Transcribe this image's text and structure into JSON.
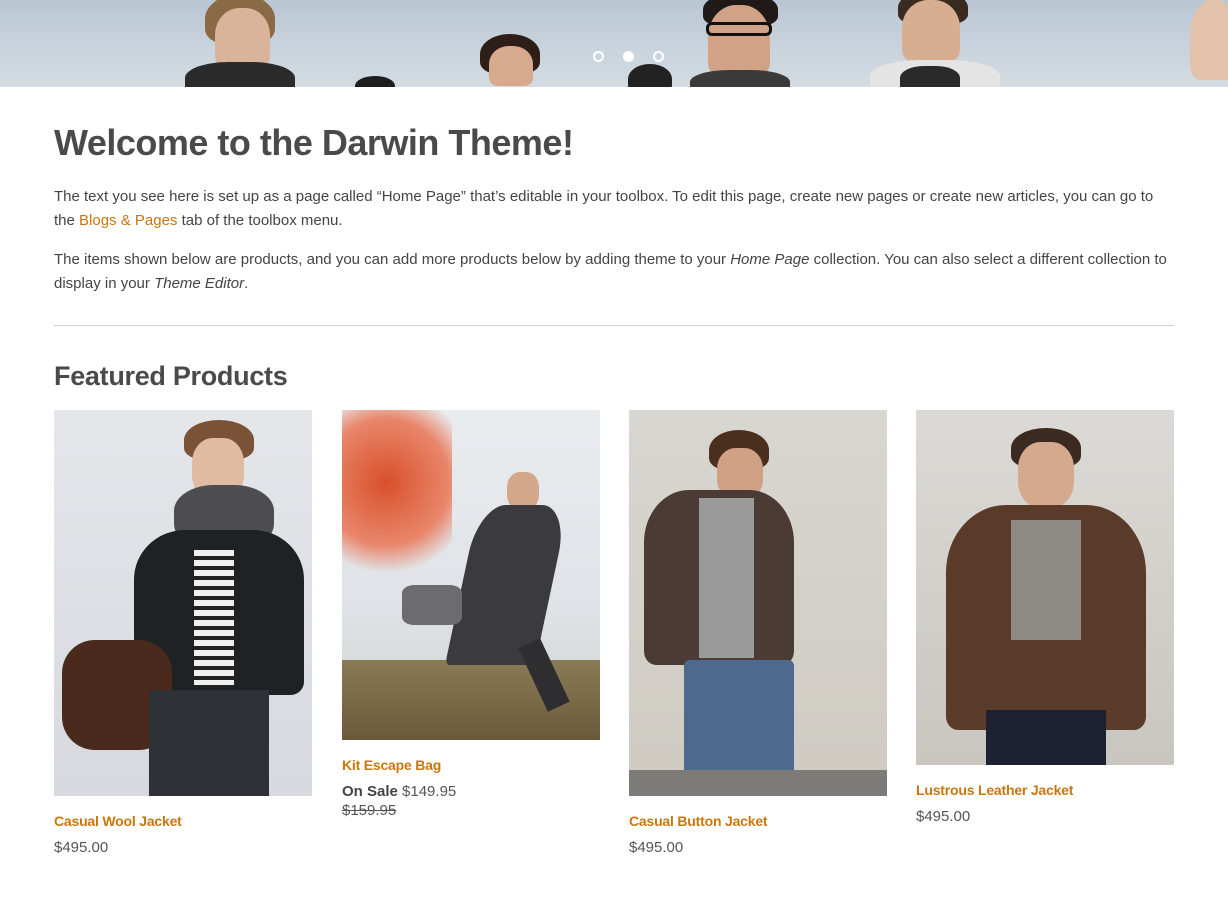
{
  "hero": {
    "slides": [
      {
        "label": "Slide 1",
        "active": false
      },
      {
        "label": "Slide 2",
        "active": true
      },
      {
        "label": "Slide 3",
        "active": false
      }
    ]
  },
  "page": {
    "title": "Welcome to the Darwin Theme!",
    "intro": {
      "p1_before": "The text you see here is set up as a page called “Home Page” that’s editable in your toolbox. To edit this page, create new pages or create new articles, you can go to the ",
      "p1_link": "Blogs & Pages",
      "p1_after": " tab of the toolbox menu.",
      "p2_before": "The items shown below are products, and you can add more products below by adding theme to your ",
      "p2_em1": "Home Page",
      "p2_mid": " collection. You can also select a different collection to display in your ",
      "p2_em2": "Theme Editor",
      "p2_after": "."
    }
  },
  "featured": {
    "heading": "Featured Products",
    "products": [
      {
        "title": "Casual Wool Jacket",
        "price": "$495.00"
      },
      {
        "title": "Kit Escape Bag",
        "on_sale_label": "On Sale",
        "price": "$149.95",
        "compare_price": "$159.95"
      },
      {
        "title": "Casual Button Jacket",
        "price": "$495.00"
      },
      {
        "title": "Lustrous Leather Jacket",
        "price": "$495.00"
      }
    ]
  },
  "colors": {
    "accent": "#c8770f",
    "text": "#444444",
    "heading": "#4a4a4a"
  }
}
